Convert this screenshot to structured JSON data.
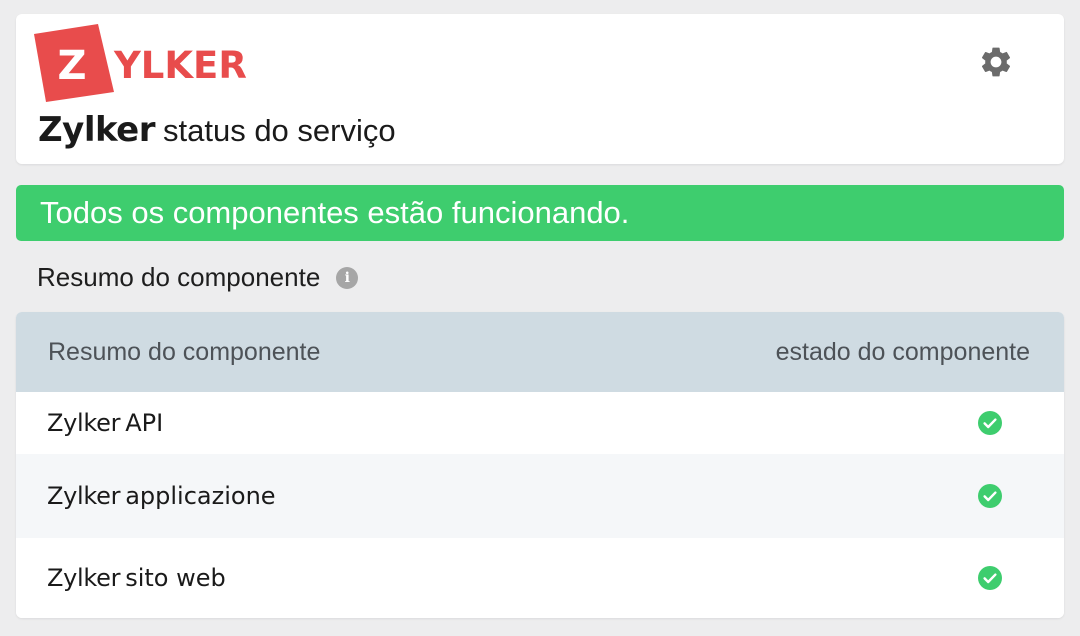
{
  "header": {
    "logo_text": "ZYLKER",
    "logo_letter": "Z",
    "logo_rest": "YLKER",
    "brand": "Zylker",
    "title_rest": "status do serviço",
    "settings_icon": "gear-icon"
  },
  "banner": {
    "text": "Todos os componentes estão funcionando.",
    "color": "#3ecd6e"
  },
  "summary": {
    "heading": "Resumo do componente",
    "info_icon": "info-icon"
  },
  "table": {
    "columns": [
      "Resumo do componente",
      "estado do componente"
    ],
    "rows": [
      {
        "brand": "Zylker",
        "name": "API",
        "status_icon": "check-circle-icon"
      },
      {
        "brand": "Zylker",
        "name": "applicazione",
        "status_icon": "check-circle-icon"
      },
      {
        "brand": "Zylker",
        "name": "sito web",
        "status_icon": "check-circle-icon"
      }
    ]
  },
  "colors": {
    "logo_red": "#e84c4c",
    "success_green": "#3ecd6e",
    "table_header_bg": "#cfdbe2",
    "page_bg": "#ededee"
  }
}
